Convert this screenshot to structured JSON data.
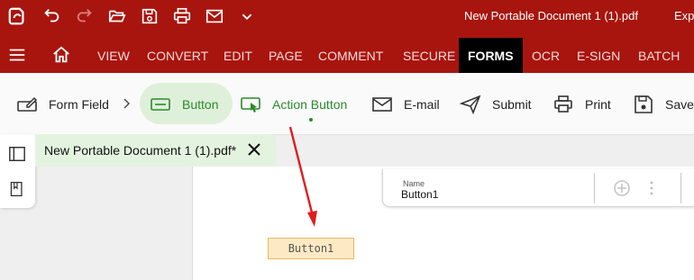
{
  "titlebar": {
    "document_title": "New Portable Document 1 (1).pdf",
    "trailing_text": "Exp",
    "icons": [
      "app-logo-icon",
      "undo-icon",
      "redo-icon",
      "open-folder-icon",
      "save-icon",
      "print-icon",
      "email-icon",
      "chevron-down-icon"
    ]
  },
  "menubar": {
    "items": [
      "VIEW",
      "CONVERT",
      "EDIT",
      "PAGE",
      "COMMENT",
      "SECURE",
      "FORMS",
      "OCR",
      "E-SIGN",
      "BATCH"
    ],
    "active": "FORMS"
  },
  "ribbon": {
    "form_field": "Form Field",
    "button": "Button",
    "action_button": "Action Button",
    "email": "E-mail",
    "submit": "Submit",
    "print": "Print",
    "save": "Save"
  },
  "doc_tab": {
    "label": "New Portable Document 1 (1).pdf*"
  },
  "properties": {
    "name_label": "Name",
    "name_value": "Button1"
  },
  "form_field_button": {
    "label": "Button1"
  },
  "colors": {
    "brand_red": "#a8150e",
    "active_tab": "#000000",
    "green_accent": "#2b8a2b",
    "annotation_arrow": "#e01b1b"
  }
}
